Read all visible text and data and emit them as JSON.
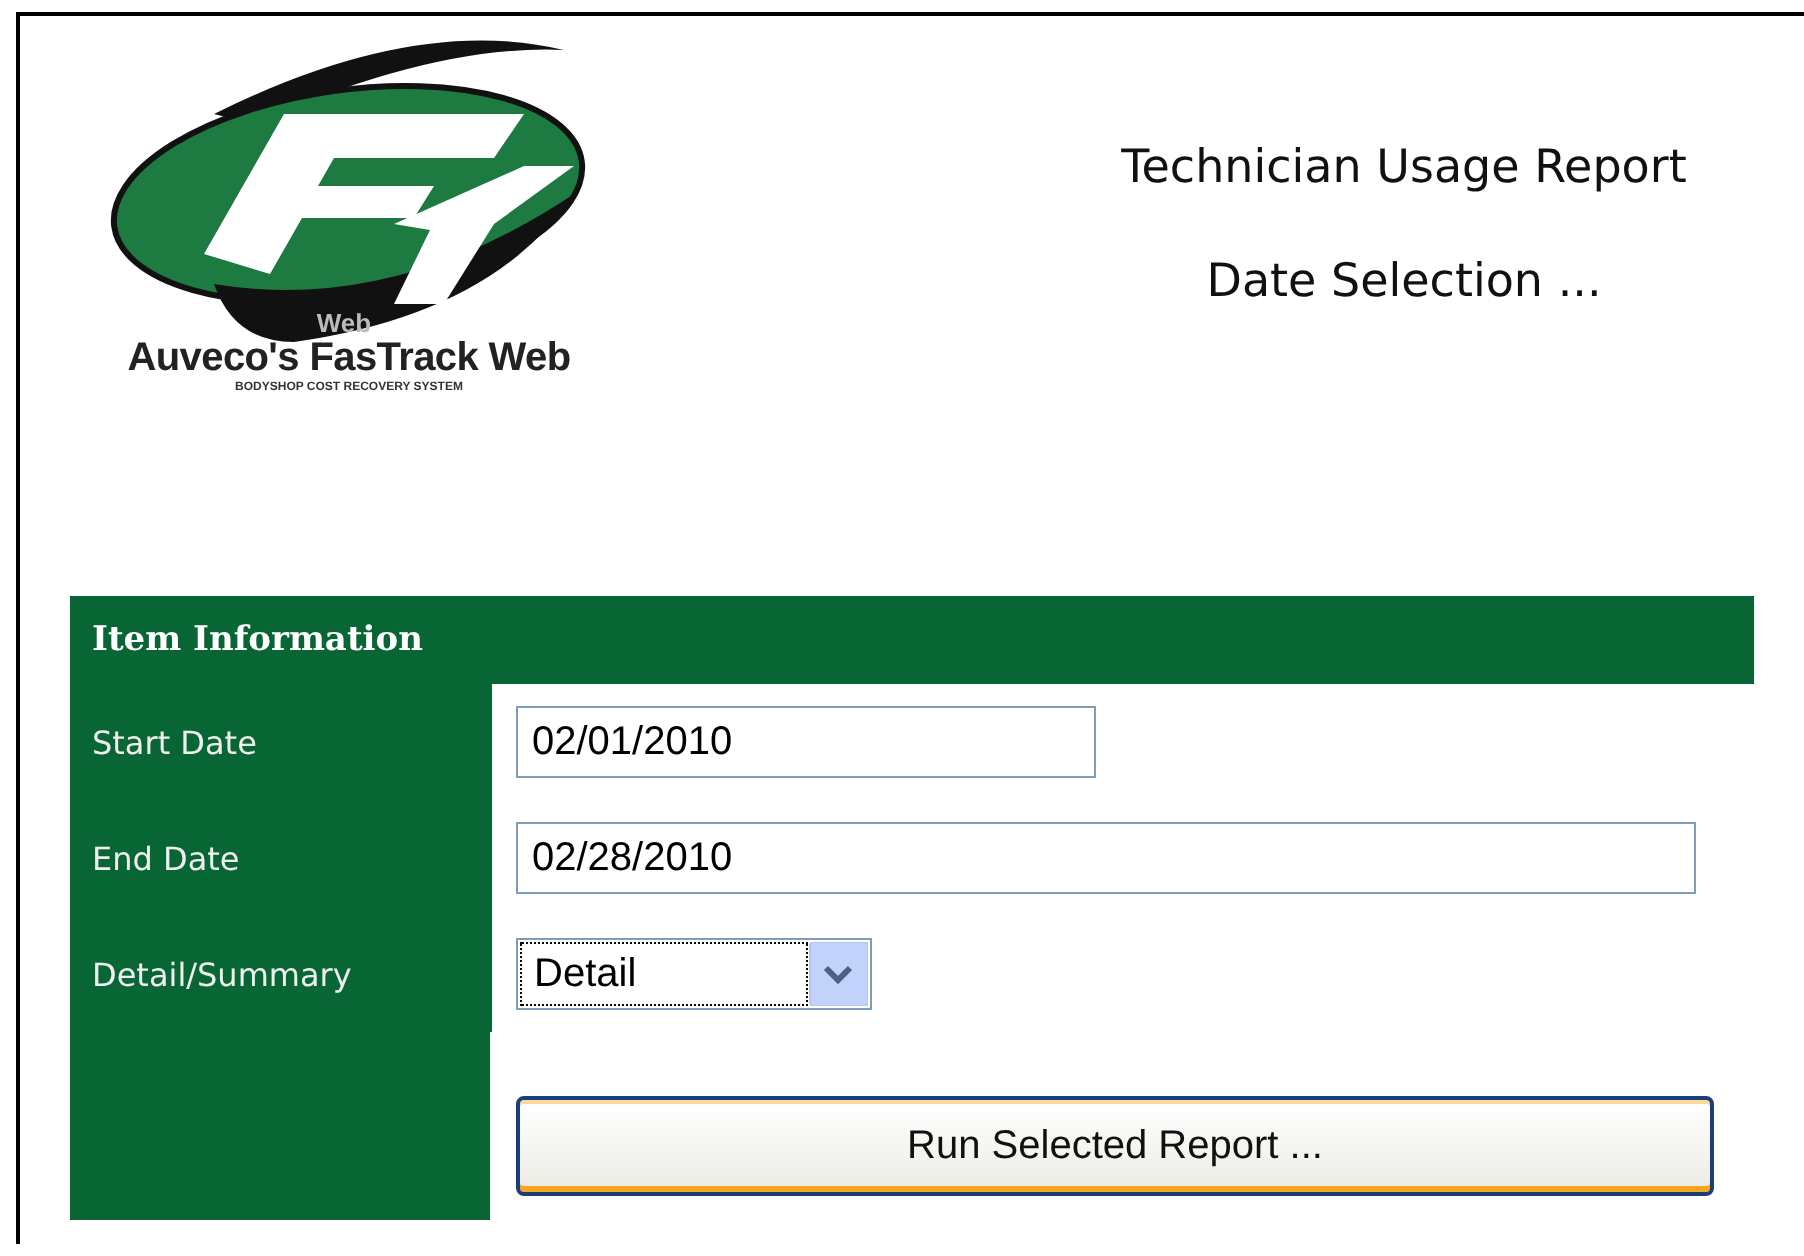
{
  "logo": {
    "badge": "Web",
    "name": "Auveco's FasTrack Web",
    "tagline": "BODYSHOP COST RECOVERY SYSTEM"
  },
  "titles": [
    "Technician Usage Report",
    "Date Selection ..."
  ],
  "panel": {
    "title": "Item Information",
    "fields": [
      {
        "kind": "text",
        "label": "Start Date",
        "value": "02/01/2010"
      },
      {
        "kind": "text",
        "label": "End Date",
        "value": "02/28/2010"
      },
      {
        "kind": "select",
        "label": "Detail/Summary",
        "value": "Detail"
      }
    ],
    "button": "Run Selected Report ..."
  }
}
